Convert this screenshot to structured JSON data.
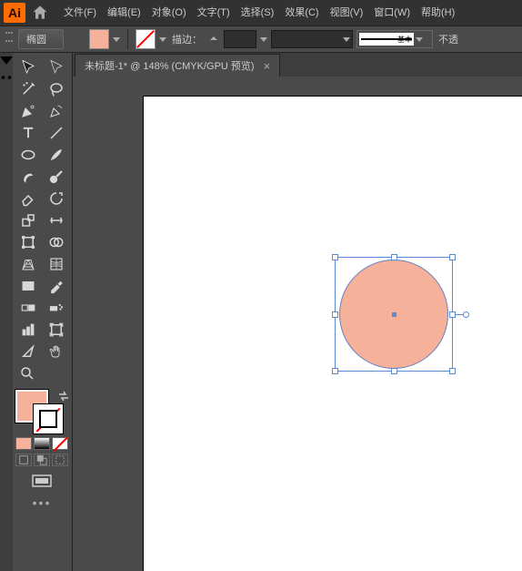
{
  "menu": {
    "items": [
      "文件(F)",
      "编辑(E)",
      "对象(O)",
      "文字(T)",
      "选择(S)",
      "效果(C)",
      "视图(V)",
      "窗口(W)",
      "帮助(H)"
    ]
  },
  "optionbar": {
    "tool_name": "椭圆",
    "fill_color": "#f5b19a",
    "stroke_label": "描边：",
    "stroke_preset": "基本",
    "opacity_label": "不透"
  },
  "tab": {
    "title": "未标题-1* @ 148% (CMYK/GPU 预览)"
  },
  "canvas": {
    "shape": "ellipse",
    "fill": "#f5b19a",
    "selected": true
  },
  "colors": {
    "fill": "#f5b19a",
    "stroke": "none",
    "mode_swatches": [
      "#f5b19a",
      "#000000",
      "none"
    ]
  }
}
